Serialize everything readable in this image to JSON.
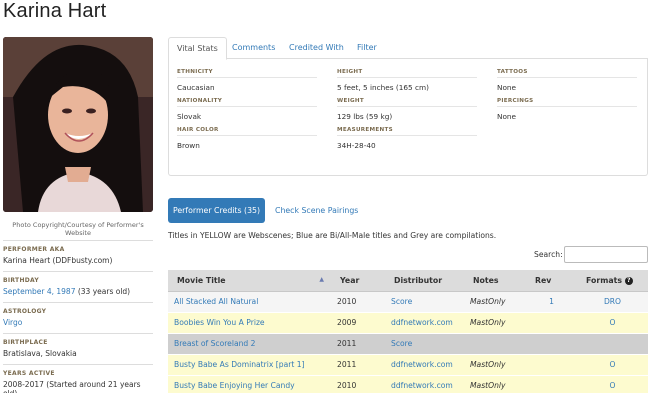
{
  "page_title": "Karina Hart",
  "photo_caption": "Photo Copyright/Courtesy of Performer's Website",
  "sidebar": [
    {
      "label": "PERFORMER AKA",
      "value": "Karina Heart (DDFbusty.com)"
    },
    {
      "label": "BIRTHDAY",
      "value_link": "September 4, 1987",
      "value_extra": " (33 years old)"
    },
    {
      "label": "ASTROLOGY",
      "value_link": "Virgo"
    },
    {
      "label": "BIRTHPLACE",
      "value": "Bratislava, Slovakia"
    },
    {
      "label": "YEARS ACTIVE",
      "value": "2008-2017 (Started around 21 years old)"
    }
  ],
  "tabs": [
    "Vital Stats",
    "Comments",
    "Credited With",
    "Filter"
  ],
  "vital_stats": {
    "col1": [
      {
        "label": "ETHNICITY",
        "value": "Caucasian"
      },
      {
        "label": "NATIONALITY",
        "value": "Slovak"
      },
      {
        "label": "HAIR COLOR",
        "value": "Brown"
      }
    ],
    "col2": [
      {
        "label": "HEIGHT",
        "value": "5 feet, 5 inches (165 cm)"
      },
      {
        "label": "WEIGHT",
        "value": "129 lbs (59 kg)"
      },
      {
        "label": "MEASUREMENTS",
        "value": "34H-28-40"
      }
    ],
    "col3": [
      {
        "label": "TATTOOS",
        "value": "None"
      },
      {
        "label": "PIERCINGS",
        "value": "None"
      }
    ]
  },
  "credits_button": "Performer Credits (35)",
  "pairings_link": "Check Scene Pairings",
  "legend_note": "Titles in YELLOW are Webscenes; Blue are Bi/All-Male titles and Grey are compilations.",
  "search_label": "Search:",
  "table": {
    "headers": [
      "Movie Title",
      "Year",
      "Distributor",
      "Notes",
      "Rev",
      "Formats"
    ],
    "rows": [
      {
        "title": "All Stacked All Natural",
        "year": "2010",
        "distributor": "Score",
        "notes": "MastOnly",
        "rev": "1",
        "formats": "DRO",
        "kind": "white"
      },
      {
        "title": "Boobies Win You A Prize",
        "year": "2009",
        "distributor": "ddfnetwork.com",
        "notes": "MastOnly",
        "rev": "",
        "formats": "O",
        "kind": "yellow"
      },
      {
        "title": "Breast of Scoreland 2",
        "year": "2011",
        "distributor": "Score",
        "notes": "",
        "rev": "",
        "formats": "",
        "kind": "grey"
      },
      {
        "title": "Busty Babe As Dominatrix [part 1]",
        "year": "2011",
        "distributor": "ddfnetwork.com",
        "notes": "MastOnly",
        "rev": "",
        "formats": "O",
        "kind": "yellow"
      },
      {
        "title": "Busty Babe Enjoying Her Candy",
        "year": "2010",
        "distributor": "ddfnetwork.com",
        "notes": "MastOnly",
        "rev": "",
        "formats": "O",
        "kind": "yellow"
      }
    ]
  }
}
